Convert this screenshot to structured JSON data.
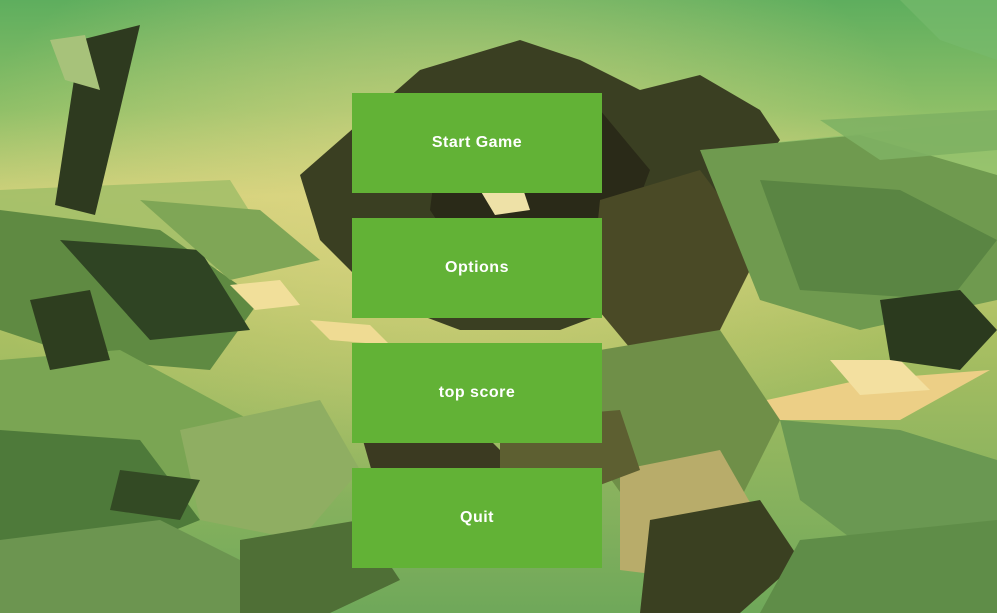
{
  "main_menu": {
    "items": [
      {
        "label": "Start Game",
        "name": "start-game-button"
      },
      {
        "label": "Options",
        "name": "options-button"
      },
      {
        "label": "top score",
        "name": "top-score-button"
      },
      {
        "label": "Quit",
        "name": "quit-button"
      }
    ]
  },
  "colors": {
    "button_fill": "#62b236",
    "button_text": "#ffffff",
    "sky_top": "#6cb664",
    "sky_mid": "#c9cf78",
    "ground": "#8fae55"
  }
}
